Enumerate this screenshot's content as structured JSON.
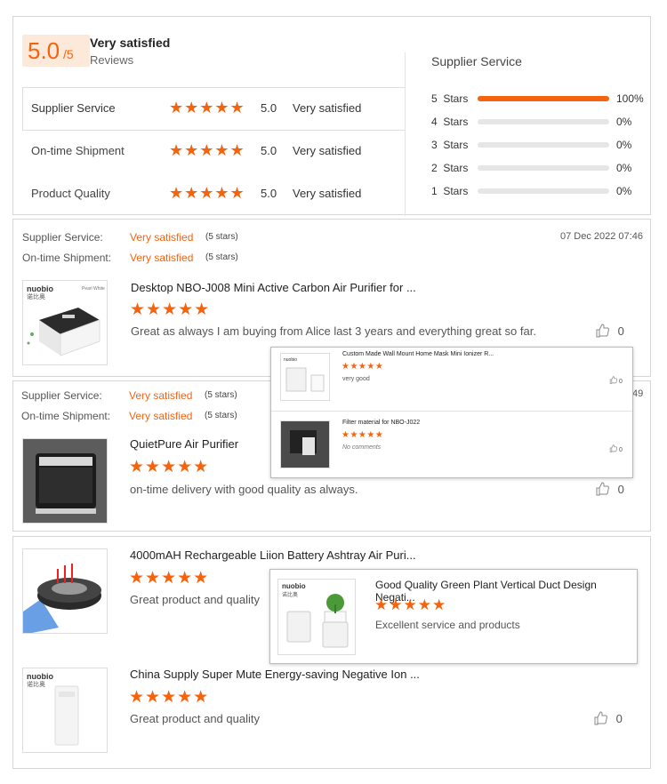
{
  "summary": {
    "score": "5.0",
    "score_den": "/5",
    "overall_label": "Very satisfied",
    "reviews_label": "Reviews",
    "rows": [
      {
        "label": "Supplier Service",
        "score": "5.0",
        "status": "Very satisfied"
      },
      {
        "label": "On-time Shipment",
        "score": "5.0",
        "status": "Very satisfied"
      },
      {
        "label": "Product Quality",
        "score": "5.0",
        "status": "Very satisfied"
      }
    ],
    "dist_title": "Supplier Service",
    "dist": [
      {
        "label": "5  Stars",
        "pct": "100%",
        "fill": 1.0
      },
      {
        "label": "4  Stars",
        "pct": "0%",
        "fill": 0
      },
      {
        "label": "3  Stars",
        "pct": "0%",
        "fill": 0
      },
      {
        "label": "2  Stars",
        "pct": "0%",
        "fill": 0
      },
      {
        "label": "1  Stars",
        "pct": "0%",
        "fill": 0
      }
    ]
  },
  "review1": {
    "supplier_label": "Supplier Service:",
    "supplier_value": "Very satisfied",
    "supplier_stars": "(5 stars)",
    "shipment_label": "On-time Shipment:",
    "shipment_value": "Very satisfied",
    "shipment_stars": "(5 stars)",
    "date": "07 Dec 2022 07:46",
    "title": "Desktop NBO-J008 Mini Active Carbon Air Purifier for ...",
    "text": "Great as always I am buying from Alice last 3 years and everything great so far.",
    "likes": "0",
    "thumb_brand": "nuobio",
    "thumb_brand_cn": "诺比奥",
    "thumb_tag": "Pearl White"
  },
  "popup1": {
    "items": [
      {
        "title": "Custom Made Wall Mount Home Mask Mini Ionizer R...",
        "text": "very good",
        "likes": "0"
      },
      {
        "title": "Filter material for NBO-J022",
        "text": "No comments",
        "likes": "0"
      }
    ]
  },
  "review2": {
    "supplier_label": "Supplier Service:",
    "supplier_value": "Very satisfied",
    "supplier_stars": "(5 stars)",
    "shipment_label": "On-time Shipment:",
    "shipment_value": "Very satisfied",
    "shipment_stars": "(5 stars)",
    "date_partial": "49",
    "title": "QuietPure Air Purifier",
    "text": "on-time delivery with good quality as always.",
    "likes": "0"
  },
  "review3": {
    "item1": {
      "title": "4000mAH Rechargeable Liion Battery Ashtray Air Puri...",
      "text": "Great product and quality"
    },
    "item2": {
      "title": "China Supply Super Mute Energy-saving Negative Ion ...",
      "text": "Great product and quality",
      "likes": "0",
      "brand": "nuobio",
      "brand_cn": "诺比奥"
    }
  },
  "popup2": {
    "title": "Good Quality Green Plant Vertical Duct Design Negati...",
    "text": "Excellent service and products",
    "brand": "nuobio",
    "brand_cn": "诺比奥"
  },
  "stars_glyph": "★★★★★",
  "colors": {
    "accent": "#f5630f",
    "accent_bg": "#fde9da",
    "bar_bg": "#e6e6e6"
  }
}
